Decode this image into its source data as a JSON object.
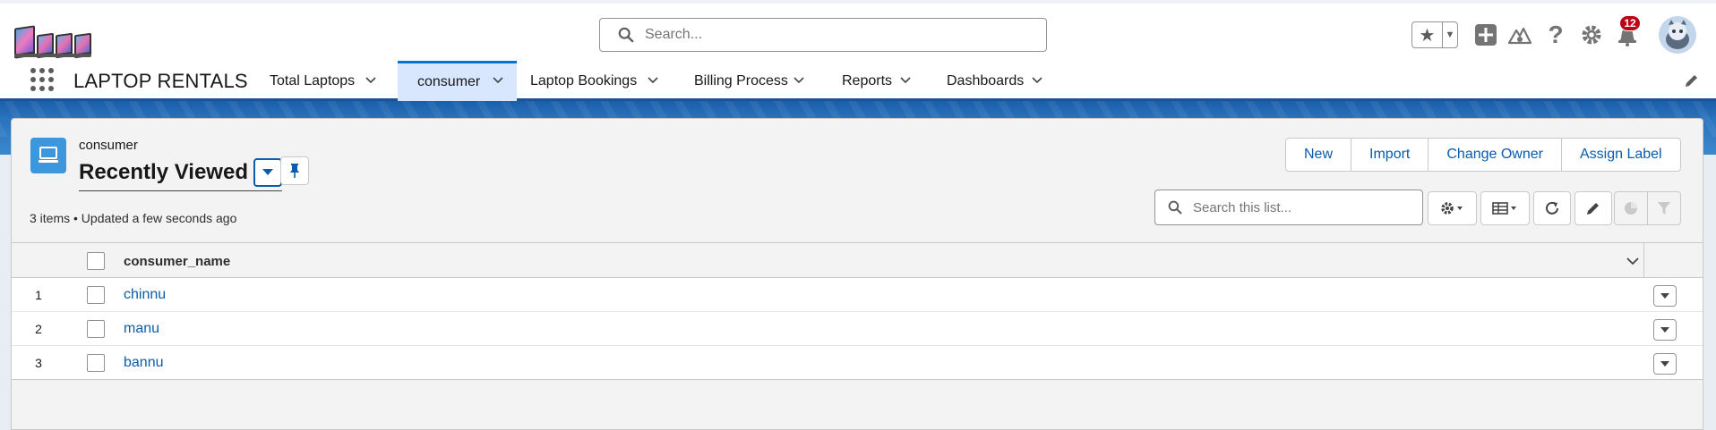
{
  "header": {
    "search_placeholder": "Search...",
    "notification_count": "12",
    "icons": [
      "favorites-star-icon",
      "add-icon",
      "trailhead-icon",
      "help-icon",
      "setup-gear-icon",
      "notification-bell-icon",
      "user-avatar"
    ]
  },
  "nav": {
    "app_name": "LAPTOP RENTALS",
    "items": [
      {
        "label": "Total Laptops",
        "active": false
      },
      {
        "label": "consumer",
        "active": true
      },
      {
        "label": "Laptop Bookings",
        "active": false
      },
      {
        "label": "Billing Process",
        "active": false
      },
      {
        "label": "Reports",
        "active": false
      },
      {
        "label": "Dashboards",
        "active": false
      }
    ]
  },
  "list_view": {
    "object_name": "consumer",
    "title": "Recently Viewed",
    "meta": "3 items • Updated a few seconds ago",
    "actions": [
      "New",
      "Import",
      "Change Owner",
      "Assign Label"
    ],
    "search_placeholder": "Search this list..."
  },
  "table": {
    "columns": [
      "consumer_name"
    ],
    "rows": [
      {
        "num": "1",
        "consumer_name": "chinnu"
      },
      {
        "num": "2",
        "consumer_name": "manu"
      },
      {
        "num": "3",
        "consumer_name": "bannu"
      }
    ]
  },
  "colors": {
    "brand_blue": "#0176d3",
    "link_blue": "#0b5cab",
    "nav_active_bg": "#d8e6fe",
    "badge_red": "#ba0517",
    "object_icon_bg": "#3c97dd"
  }
}
